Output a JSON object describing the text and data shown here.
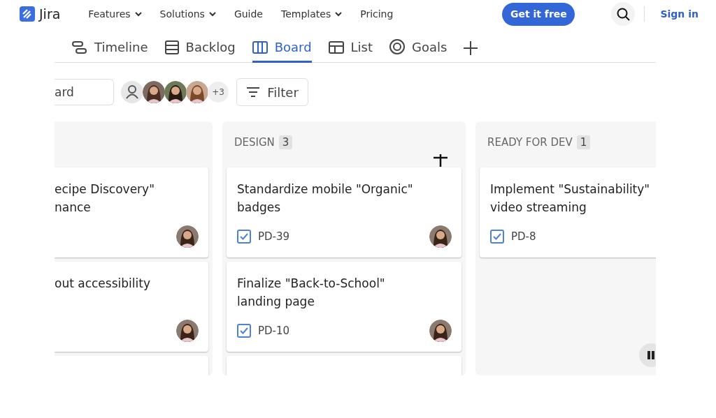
{
  "header": {
    "logo": "Jira",
    "nav": [
      {
        "label": "Features",
        "dropdown": true
      },
      {
        "label": "Solutions",
        "dropdown": true
      },
      {
        "label": "Guide",
        "dropdown": false
      },
      {
        "label": "Templates",
        "dropdown": true
      },
      {
        "label": "Pricing",
        "dropdown": false
      }
    ],
    "cta": "Get it free",
    "sign_in": "Sign in"
  },
  "board": {
    "tabs": [
      {
        "label": "Timeline",
        "selected": false
      },
      {
        "label": "Backlog",
        "selected": false
      },
      {
        "label": "Board",
        "selected": true
      },
      {
        "label": "List",
        "selected": false
      },
      {
        "label": "Goals",
        "selected": false
      }
    ],
    "search": {
      "value": "ard"
    },
    "avatars_more": "+3",
    "filter": "Filter",
    "columns": [
      {
        "cards": [
          {
            "kind": "full",
            "lines": [
              "ecipe Discovery\"",
              "nance"
            ],
            "assignee": true
          },
          {
            "kind": "full",
            "lines": [
              "out accessibility"
            ],
            "assignee": true
          },
          {
            "kind": "partial"
          }
        ]
      },
      {
        "title": "DESIGN",
        "count": "3",
        "cards": [
          {
            "kind": "full",
            "lines": [
              "Standardize mobile \"Organic\"",
              "badges"
            ],
            "key": "PD-39",
            "assignee": true
          },
          {
            "kind": "full",
            "lines": [
              "Finalize \"Back-to-School\"",
              "landing page"
            ],
            "key": "PD-10",
            "assignee": true
          },
          {
            "kind": "partial"
          }
        ]
      },
      {
        "title": "READY FOR DEV",
        "count": "1",
        "cards": [
          {
            "kind": "full",
            "lines": [
              "Implement \"Sustainability\"",
              "video streaming"
            ],
            "key": "PD-8",
            "assignee": false
          }
        ]
      }
    ]
  }
}
